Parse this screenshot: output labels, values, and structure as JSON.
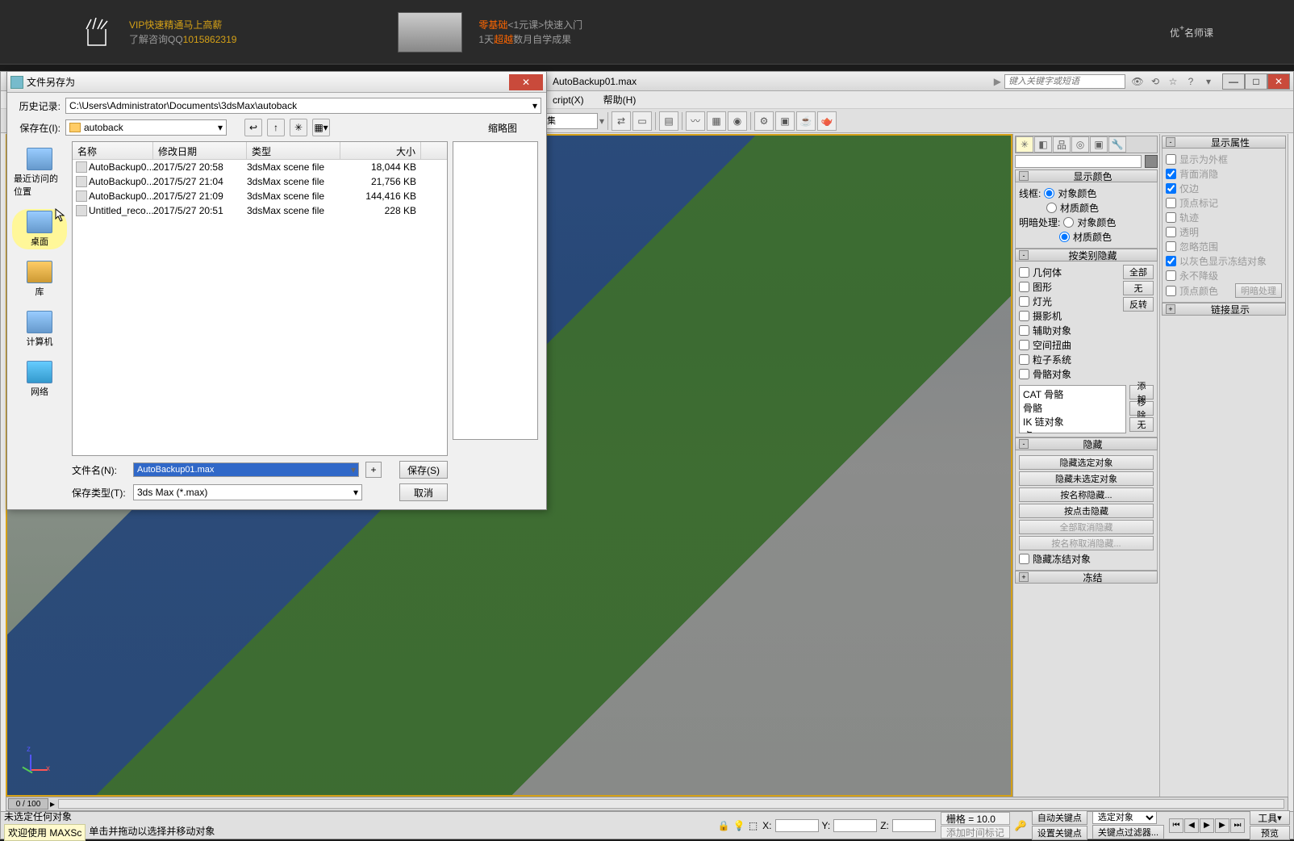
{
  "banner": {
    "line1_a": "VIP快速精通马上高薪",
    "line1_b": "了解咨询QQ",
    "qq": "1015862319",
    "center_a": "零基础",
    "center_b": "<1元课>",
    "center_c": "快速入门",
    "center_d": "1天",
    "center_e": "超越",
    "center_f": "数月自学成果",
    "right": "优",
    "right2": "名师课"
  },
  "app": {
    "title": "AutoBackup01.max",
    "search_placeholder": "键入关键字或短语",
    "menu": {
      "script": "cript(X)",
      "help": "帮助(H)"
    },
    "toolbar_combo": "选择集"
  },
  "dialog": {
    "title": "文件另存为",
    "history_label": "历史记录:",
    "history_value": "C:\\Users\\Administrator\\Documents\\3dsMax\\autoback",
    "savein_label": "保存在(I):",
    "savein_value": "autoback",
    "preview_label": "缩略图",
    "places": {
      "recent": "最近访问的位置",
      "desktop": "桌面",
      "library": "库",
      "computer": "计算机",
      "network": "网络"
    },
    "cols": {
      "name": "名称",
      "date": "修改日期",
      "type": "类型",
      "size": "大小"
    },
    "files": [
      {
        "name": "AutoBackup0...",
        "date": "2017/5/27 20:58",
        "type": "3dsMax scene file",
        "size": "18,044 KB"
      },
      {
        "name": "AutoBackup0...",
        "date": "2017/5/27 21:04",
        "type": "3dsMax scene file",
        "size": "21,756 KB"
      },
      {
        "name": "AutoBackup0...",
        "date": "2017/5/27 21:09",
        "type": "3dsMax scene file",
        "size": "144,416 KB"
      },
      {
        "name": "Untitled_reco...",
        "date": "2017/5/27 20:51",
        "type": "3dsMax scene file",
        "size": "228 KB"
      }
    ],
    "filename_label": "文件名(N):",
    "filename_value": "AutoBackup01.max",
    "filetype_label": "保存类型(T):",
    "filetype_value": "3ds Max (*.max)",
    "save_btn": "保存(S)",
    "cancel_btn": "取消",
    "plus": "+"
  },
  "panel": {
    "color_header": "显示颜色",
    "wireframe": "线框:",
    "obj_color": "对象颜色",
    "mat_color": "材质颜色",
    "shade": "明暗处理:",
    "hide_cat_header": "按类别隐藏",
    "cats": {
      "geom": "几何体",
      "shape": "图形",
      "light": "灯光",
      "camera": "摄影机",
      "helper": "辅助对象",
      "warp": "空间扭曲",
      "particle": "粒子系统",
      "bone": "骨骼对象"
    },
    "btns": {
      "all": "全部",
      "none": "无",
      "invert": "反转",
      "add": "添加",
      "remove": "移除",
      "none2": "无"
    },
    "list": {
      "cat": "CAT 骨骼",
      "bone": "骨骼",
      "ik": "IK 链对象",
      "point": "点"
    },
    "hide_header": "隐藏",
    "hide_btns": {
      "sel": "隐藏选定对象",
      "unsel": "隐藏未选定对象",
      "byname": "按名称隐藏...",
      "byhit": "按点击隐藏",
      "unhideall": "全部取消隐藏",
      "unhidename": "按名称取消隐藏..."
    },
    "hide_frozen": "隐藏冻结对象",
    "freeze_header": "冻结",
    "disp_header": "显示属性",
    "props": {
      "box": "显示为外框",
      "backface": "背面消隐",
      "edges": "仅边",
      "vtick": "顶点标记",
      "traj": "轨迹",
      "trans": "透明",
      "ignore": "忽略范围",
      "grayfrz": "以灰色显示冻结对象",
      "nodegrade": "永不降级",
      "vcolor": "顶点颜色"
    },
    "shade_btn": "明暗处理",
    "link_header": "链接显示"
  },
  "status": {
    "frame": "0 / 100",
    "nosel": "未选定任何对象",
    "prompt": "欢迎使用  MAXSc",
    "hint": "单击并拖动以选择并移动对象",
    "grid": "栅格 = 10.0",
    "autokey": "自动关键点",
    "setkey": "设置关键点",
    "selobj": "选定对象",
    "keyfilter": "关键点过滤器...",
    "addtime": "添加时间标记",
    "tools": "工具",
    "preview": "预览",
    "x": "X:",
    "y": "Y:",
    "z": "Z:"
  }
}
